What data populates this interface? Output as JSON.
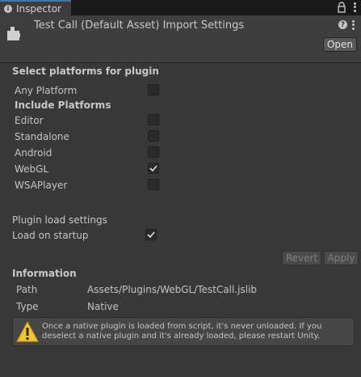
{
  "tab": {
    "label": "Inspector",
    "icon": "info-icon"
  },
  "header": {
    "title": "Test Call (Default Asset) Import Settings",
    "open_button": "Open",
    "help_glyph": "?"
  },
  "platforms": {
    "title": "Select platforms for plugin",
    "any_platform": {
      "label": "Any Platform",
      "checked": false
    },
    "include_title": "Include Platforms",
    "items": [
      {
        "label": "Editor",
        "checked": false
      },
      {
        "label": "Standalone",
        "checked": false
      },
      {
        "label": "Android",
        "checked": false
      },
      {
        "label": "WebGL",
        "checked": true
      },
      {
        "label": "WSAPlayer",
        "checked": false
      }
    ]
  },
  "load_settings": {
    "title": "Plugin load settings",
    "load_on_startup": {
      "label": "Load on startup",
      "checked": true
    }
  },
  "actions": {
    "revert": "Revert",
    "apply": "Apply"
  },
  "information": {
    "title": "Information",
    "path_label": "Path",
    "path_value": "Assets/Plugins/WebGL/TestCall.jslib",
    "type_label": "Type",
    "type_value": "Native",
    "warning": "Once a native plugin is loaded from script, it's never unloaded. If you deselect a native plugin and it's already loaded, please restart Unity."
  },
  "colors": {
    "accent": "#3a79bb",
    "warning": "#f4c430",
    "background": "#383838"
  }
}
